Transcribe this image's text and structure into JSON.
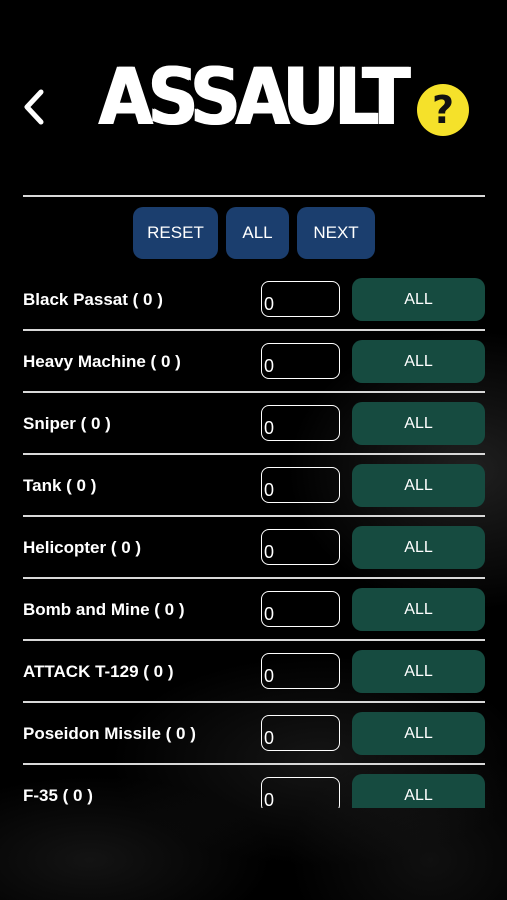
{
  "header": {
    "title": "ASSAULT",
    "back_icon": "chevron-left-icon",
    "help_label": "?",
    "help_color": "#f5e12a"
  },
  "toolbar": {
    "reset_label": "RESET",
    "all_label": "ALL",
    "next_label": "NEXT",
    "button_color": "#1b3e6e"
  },
  "items": [
    {
      "label": "Black Passat ( 0 )",
      "value": "0",
      "button": "ALL"
    },
    {
      "label": "Heavy Machine ( 0 )",
      "value": "0",
      "button": "ALL"
    },
    {
      "label": "Sniper ( 0 )",
      "value": "0",
      "button": "ALL"
    },
    {
      "label": "Tank ( 0 )",
      "value": "0",
      "button": "ALL"
    },
    {
      "label": "Helicopter ( 0 )",
      "value": "0",
      "button": "ALL"
    },
    {
      "label": "Bomb and Mine ( 0 )",
      "value": "0",
      "button": "ALL"
    },
    {
      "label": "ATTACK T-129 ( 0 )",
      "value": "0",
      "button": "ALL"
    },
    {
      "label": "Poseidon Missile ( 0 )",
      "value": "0",
      "button": "ALL"
    },
    {
      "label": "F-35 ( 0 )",
      "value": "0",
      "button": "ALL"
    }
  ],
  "colors": {
    "background": "#000000",
    "row_button": "#164b40"
  }
}
